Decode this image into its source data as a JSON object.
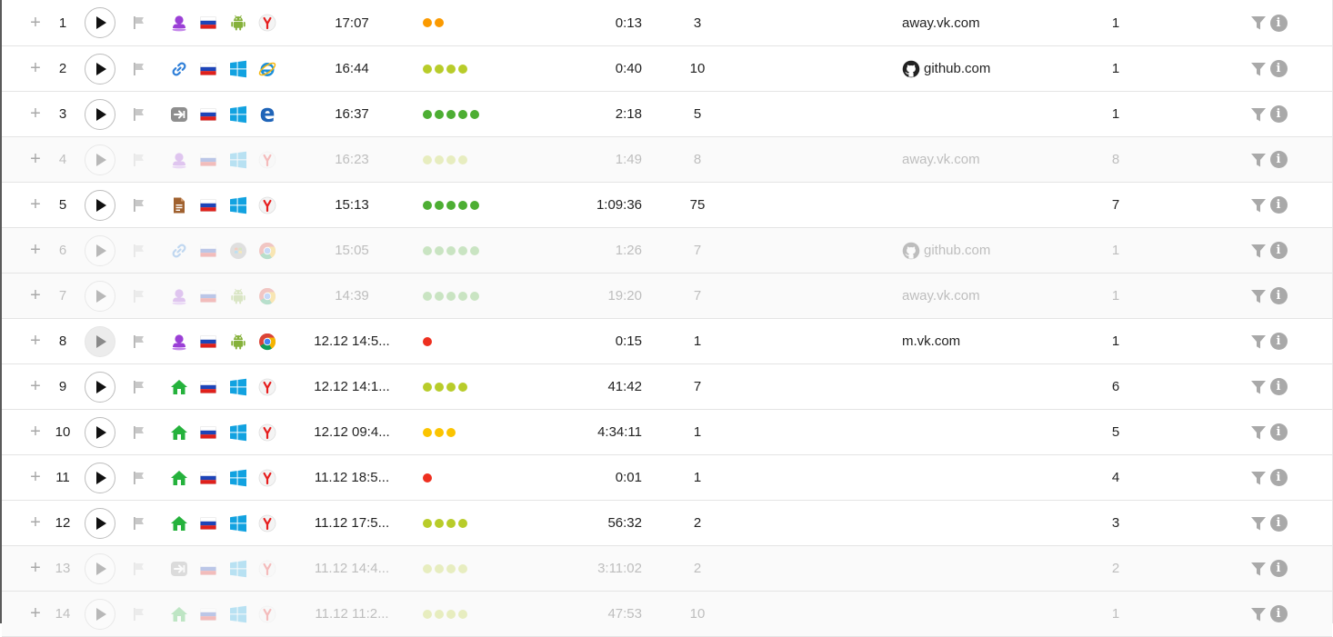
{
  "colors": {
    "dot_red": "#ee2f1f",
    "dot_orange": "#fb9a00",
    "dot_yellow": "#fbc400",
    "dot_lime": "#b8cc2a",
    "dot_green": "#4dae33",
    "play_icon": "#111111",
    "muted_icon": "#a9a9a9"
  },
  "icons": {
    "plus": "+",
    "info": "i"
  },
  "rows": [
    {
      "num": "1",
      "source": "person",
      "country": "ru",
      "os": "android",
      "browser": "yandex",
      "time": "17:07",
      "dots": {
        "count": 2,
        "color": "orange"
      },
      "duration": "0:13",
      "pages": "3",
      "referrer": "away.vk.com",
      "referrer_icon": "",
      "depth": "1",
      "faded": false,
      "play_hover": false
    },
    {
      "num": "2",
      "source": "link",
      "country": "ru",
      "os": "windows",
      "browser": "ie",
      "time": "16:44",
      "dots": {
        "count": 4,
        "color": "lime"
      },
      "duration": "0:40",
      "pages": "10",
      "referrer": "github.com",
      "referrer_icon": "github",
      "depth": "1",
      "faded": false,
      "play_hover": false
    },
    {
      "num": "3",
      "source": "direct",
      "country": "ru",
      "os": "windows",
      "browser": "edge",
      "time": "16:37",
      "dots": {
        "count": 5,
        "color": "green"
      },
      "duration": "2:18",
      "pages": "5",
      "referrer": "",
      "referrer_icon": "",
      "depth": "1",
      "faded": false,
      "play_hover": false
    },
    {
      "num": "4",
      "source": "person",
      "country": "ru",
      "os": "windows",
      "browser": "yandex",
      "time": "16:23",
      "dots": {
        "count": 4,
        "color": "lime"
      },
      "duration": "1:49",
      "pages": "8",
      "referrer": "away.vk.com",
      "referrer_icon": "",
      "depth": "8",
      "faded": true,
      "play_hover": false
    },
    {
      "num": "5",
      "source": "document",
      "country": "ru",
      "os": "windows",
      "browser": "yandex",
      "time": "15:13",
      "dots": {
        "count": 5,
        "color": "green"
      },
      "duration": "1:09:36",
      "pages": "75",
      "referrer": "",
      "referrer_icon": "",
      "depth": "7",
      "faded": false,
      "play_hover": false
    },
    {
      "num": "6",
      "source": "link",
      "country": "ru",
      "os": "windows7",
      "browser": "chrome",
      "time": "15:05",
      "dots": {
        "count": 5,
        "color": "green"
      },
      "duration": "1:26",
      "pages": "7",
      "referrer": "github.com",
      "referrer_icon": "github",
      "depth": "1",
      "faded": true,
      "play_hover": false
    },
    {
      "num": "7",
      "source": "person",
      "country": "ru",
      "os": "android",
      "browser": "chrome",
      "time": "14:39",
      "dots": {
        "count": 5,
        "color": "green"
      },
      "duration": "19:20",
      "pages": "7",
      "referrer": "away.vk.com",
      "referrer_icon": "",
      "depth": "1",
      "faded": true,
      "play_hover": false
    },
    {
      "num": "8",
      "source": "person",
      "country": "ru",
      "os": "android",
      "browser": "chrome",
      "time": "12.12 14:5...",
      "dots": {
        "count": 1,
        "color": "red"
      },
      "duration": "0:15",
      "pages": "1",
      "referrer": "m.vk.com",
      "referrer_icon": "",
      "depth": "1",
      "faded": false,
      "play_hover": true
    },
    {
      "num": "9",
      "source": "home",
      "country": "ru",
      "os": "windows",
      "browser": "yandex",
      "time": "12.12 14:1...",
      "dots": {
        "count": 4,
        "color": "lime"
      },
      "duration": "41:42",
      "pages": "7",
      "referrer": "",
      "referrer_icon": "",
      "depth": "6",
      "faded": false,
      "play_hover": false
    },
    {
      "num": "10",
      "source": "home",
      "country": "ru",
      "os": "windows",
      "browser": "yandex",
      "time": "12.12 09:4...",
      "dots": {
        "count": 3,
        "color": "yellow"
      },
      "duration": "4:34:11",
      "pages": "1",
      "referrer": "",
      "referrer_icon": "",
      "depth": "5",
      "faded": false,
      "play_hover": false
    },
    {
      "num": "11",
      "source": "home",
      "country": "ru",
      "os": "windows",
      "browser": "yandex",
      "time": "11.12 18:5...",
      "dots": {
        "count": 1,
        "color": "red"
      },
      "duration": "0:01",
      "pages": "1",
      "referrer": "",
      "referrer_icon": "",
      "depth": "4",
      "faded": false,
      "play_hover": false
    },
    {
      "num": "12",
      "source": "home",
      "country": "ru",
      "os": "windows",
      "browser": "yandex",
      "time": "11.12 17:5...",
      "dots": {
        "count": 4,
        "color": "lime"
      },
      "duration": "56:32",
      "pages": "2",
      "referrer": "",
      "referrer_icon": "",
      "depth": "3",
      "faded": false,
      "play_hover": false
    },
    {
      "num": "13",
      "source": "direct",
      "country": "ru",
      "os": "windows",
      "browser": "yandex",
      "time": "11.12 14:4...",
      "dots": {
        "count": 4,
        "color": "lime"
      },
      "duration": "3:11:02",
      "pages": "2",
      "referrer": "",
      "referrer_icon": "",
      "depth": "2",
      "faded": true,
      "play_hover": false
    },
    {
      "num": "14",
      "source": "home",
      "country": "ru",
      "os": "windows",
      "browser": "yandex",
      "time": "11.12 11:2...",
      "dots": {
        "count": 4,
        "color": "lime"
      },
      "duration": "47:53",
      "pages": "10",
      "referrer": "",
      "referrer_icon": "",
      "depth": "1",
      "faded": true,
      "play_hover": false
    }
  ]
}
